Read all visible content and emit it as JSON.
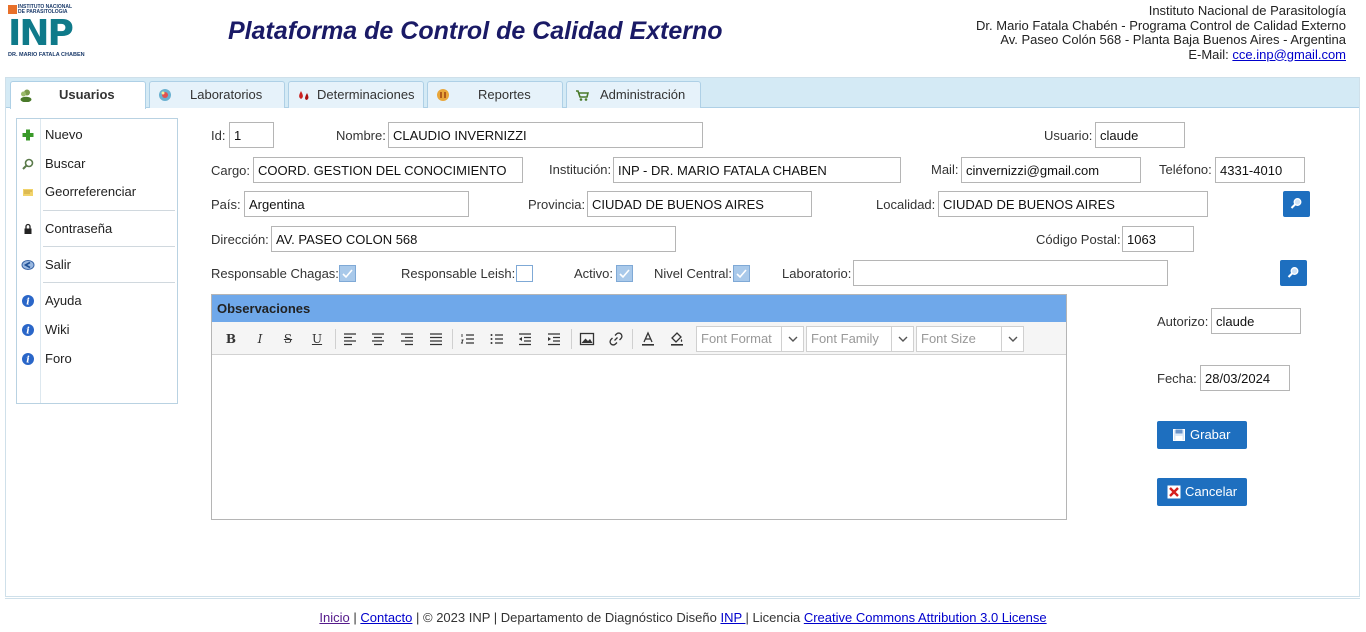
{
  "logo": {
    "top_line1": "INSTITUTO NACIONAL",
    "top_line2": "DE PARASITOLOGIA",
    "letters": "INP",
    "bottom_line": "DR. MARIO FATALA CHABEN"
  },
  "header": {
    "title": "Plataforma de Control de Calidad Externo",
    "info_line1": "Instituto Nacional de Parasitología",
    "info_line2": "Dr. Mario Fatala Chabén - Programa Control de Calidad Externo",
    "info_line3": "Av. Paseo Colón 568 - Planta Baja Buenos Aires - Argentina",
    "email_label": "E-Mail: ",
    "email": "cce.inp@gmail.com"
  },
  "tabs": [
    {
      "label": "Usuarios",
      "icon": "users-icon"
    },
    {
      "label": "Laboratorios",
      "icon": "lab-icon"
    },
    {
      "label": "Determinaciones",
      "icon": "drops-icon"
    },
    {
      "label": "Reportes",
      "icon": "reports-icon"
    },
    {
      "label": "Administración",
      "icon": "cart-icon"
    }
  ],
  "menu": [
    {
      "label": "Nuevo",
      "icon": "plus-icon"
    },
    {
      "label": "Buscar",
      "icon": "magnifier-icon"
    },
    {
      "label": "Georreferenciar",
      "icon": "map-icon"
    },
    {
      "label": "Contraseña",
      "icon": "lock-icon"
    },
    {
      "label": "Salir",
      "icon": "exit-icon"
    },
    {
      "label": "Ayuda",
      "icon": "info-icon"
    },
    {
      "label": "Wiki",
      "icon": "info-icon"
    },
    {
      "label": "Foro",
      "icon": "info-icon"
    }
  ],
  "form": {
    "id": {
      "label": "Id:",
      "value": "1"
    },
    "nombre": {
      "label": "Nombre:",
      "value": "CLAUDIO INVERNIZZI"
    },
    "usuario": {
      "label": "Usuario:",
      "value": "claude"
    },
    "cargo": {
      "label": "Cargo:",
      "value": "COORD. GESTION DEL CONOCIMIENTO"
    },
    "institucion": {
      "label": "Institución:",
      "value": "INP - DR. MARIO FATALA CHABEN"
    },
    "mail": {
      "label": "Mail:",
      "value": "cinvernizzi@gmail.com"
    },
    "telefono": {
      "label": "Teléfono:",
      "value": "4331-4010"
    },
    "pais": {
      "label": "País:",
      "value": "Argentina"
    },
    "provincia": {
      "label": "Provincia:",
      "value": "CIUDAD DE BUENOS AIRES"
    },
    "localidad": {
      "label": "Localidad:",
      "value": "CIUDAD DE BUENOS AIRES"
    },
    "direccion": {
      "label": "Dirección:",
      "value": "AV. PASEO COLON 568"
    },
    "codigo_postal": {
      "label": "Código Postal:",
      "value": "1063"
    },
    "resp_chagas": {
      "label": "Responsable Chagas:",
      "checked": true
    },
    "resp_leish": {
      "label": "Responsable Leish:",
      "checked": false
    },
    "activo": {
      "label": "Activo:",
      "checked": true
    },
    "nivel_central": {
      "label": "Nivel Central:",
      "checked": true
    },
    "laboratorio": {
      "label": "Laboratorio:",
      "value": ""
    },
    "autorizo": {
      "label": "Autorizo:",
      "value": "claude"
    },
    "fecha": {
      "label": "Fecha:",
      "value": "28/03/2024"
    }
  },
  "editor": {
    "title": "Observaciones",
    "font_format_placeholder": "Font Format",
    "font_family_placeholder": "Font Family",
    "font_size_placeholder": "Font Size"
  },
  "actions": {
    "save_label": "Grabar",
    "cancel_label": "Cancelar"
  },
  "footer": {
    "inicio": "Inicio",
    "sep1": " | ",
    "contacto": "Contacto",
    "middle": " | © 2023 INP | Departamento de Diagnóstico Diseño ",
    "inp": "INP ",
    "licencia": "| Licencia ",
    "license_link": "Creative Commons Attribution 3.0 License"
  },
  "colors": {
    "accent": "#1e6fbf",
    "title": "#1a1a66",
    "tabbar": "#d4eaf5",
    "editor_header": "#6fa8ea"
  }
}
